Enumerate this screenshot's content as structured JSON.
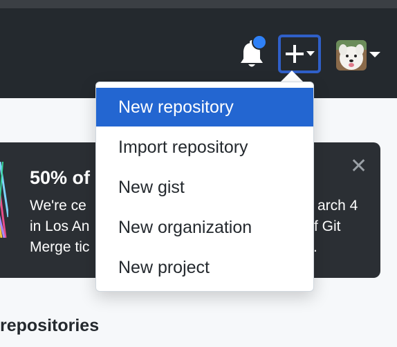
{
  "header": {
    "notification_icon": "bell-icon",
    "create_icon": "plus-icon",
    "avatar_alt": "user avatar (white dog)"
  },
  "banner": {
    "title": "50% of",
    "line1_left": "We're ce",
    "line1_right": "arch 4",
    "line2_left": "in Los An",
    "line2_right": "f Git",
    "line3_left": "Merge tic",
    "line3_right": "."
  },
  "section": {
    "title": "repositories"
  },
  "dropdown": {
    "items": [
      {
        "label": "New repository",
        "active": true
      },
      {
        "label": "Import repository",
        "active": false
      },
      {
        "label": "New gist",
        "active": false
      },
      {
        "label": "New organization",
        "active": false
      },
      {
        "label": "New project",
        "active": false
      }
    ]
  },
  "colors": {
    "header_bg": "#24292e",
    "active_item": "#2366d1",
    "notification_dot": "#2f81f7",
    "focus_ring": "#2f5fc8"
  }
}
